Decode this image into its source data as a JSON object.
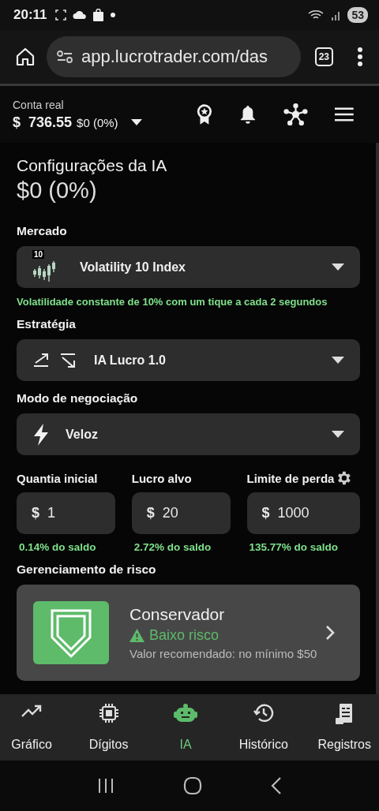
{
  "status_bar": {
    "time": "20:11",
    "battery": "53"
  },
  "browser": {
    "url": "app.lucrotrader.com/das",
    "tab_count": "23"
  },
  "account": {
    "label": "Conta real",
    "currency": "$",
    "balance": "736.55",
    "change": "$0 (0%)"
  },
  "page": {
    "title": "Configurações da IA",
    "profit": "$0 (0%)"
  },
  "market": {
    "label": "Mercado",
    "badge": "10",
    "value": "Volatility 10 Index",
    "hint": "Volatilidade constante de 10% com um tique a cada 2 segundos"
  },
  "strategy": {
    "label": "Estratégia",
    "value": "IA Lucro 1.0"
  },
  "mode": {
    "label": "Modo de negociação",
    "value": "Veloz"
  },
  "amounts": [
    {
      "label": "Quantia inicial",
      "prefix": "$",
      "value": "1",
      "note": "0.14% do saldo",
      "settings": false
    },
    {
      "label": "Lucro alvo",
      "prefix": "$",
      "value": "20",
      "note": "2.72% do saldo",
      "settings": false
    },
    {
      "label": "Limite de perda",
      "prefix": "$",
      "value": "1000",
      "note": "135.77% do saldo",
      "settings": true
    }
  ],
  "risk": {
    "label": "Gerenciamento de risco",
    "title": "Conservador",
    "level": "Baixo risco",
    "note": "Valor recomendado: no mínimo $50"
  },
  "nav": [
    {
      "label": "Gráfico",
      "selected": false
    },
    {
      "label": "Dígitos",
      "selected": false
    },
    {
      "label": "IA",
      "selected": true
    },
    {
      "label": "Histórico",
      "selected": false
    },
    {
      "label": "Registros",
      "selected": false
    }
  ]
}
